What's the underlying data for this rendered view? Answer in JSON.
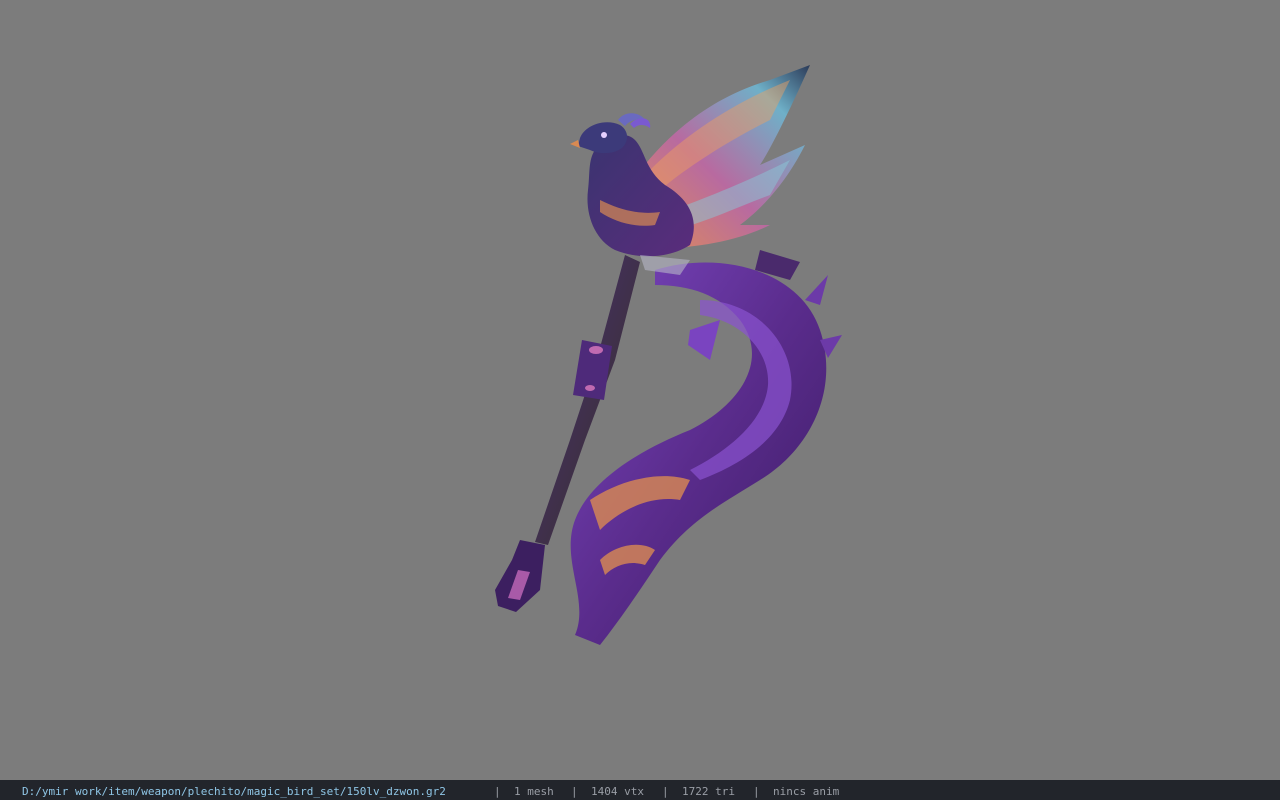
{
  "viewport": {
    "background_color": "#7c7c7c",
    "model_name": "magic bird staff weapon model"
  },
  "status": {
    "file_path": "D:/ymir work/item/weapon/plechito/magic_bird_set/150lv_dzwon.gr2",
    "separator": "|",
    "mesh_count": "1 mesh",
    "vertex_count": "1404 vtx",
    "triangle_count": "1722 tri",
    "anim_status": "nincs anim"
  },
  "colors": {
    "statusbar_bg": "#22252b",
    "path_text": "#8fc6e6",
    "stat_text": "#9a9ea6",
    "model_purple": "#5a2c8c",
    "model_orange": "#d98a52"
  }
}
